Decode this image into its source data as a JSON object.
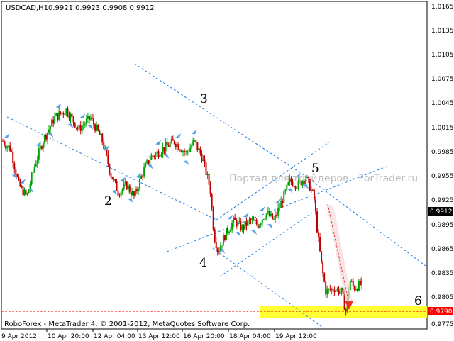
{
  "header": {
    "symbol": "USDCAD,H1",
    "ohlc": "0.9921 0.9923 0.9908 0.9912"
  },
  "footer": {
    "broker": "RoboForex - MetaTrader 4, © 2001-2012, MetaQuotes Software Corp."
  },
  "watermark": "Портал для трейдеров - ForTrader.ru",
  "price_axis": {
    "ticks": [
      "1.0165",
      "1.0135",
      "1.0105",
      "1.0075",
      "1.0045",
      "1.0015",
      "0.9985",
      "0.9955",
      "0.9925",
      "0.9895",
      "0.9865",
      "0.9835",
      "0.9805",
      "0.9775"
    ],
    "current_price": "0.9912",
    "target_price": "0.9790"
  },
  "time_axis": {
    "ticks": [
      "9 Apr 2012",
      "10 Apr 20:00",
      "12 Apr 04:00",
      "13 Apr 12:00",
      "16 Apr 20:00",
      "18 Apr 04:00",
      "19 Apr 12:00"
    ]
  },
  "wave_labels": [
    "2",
    "3",
    "4",
    "5",
    "6"
  ],
  "colors": {
    "bull": "#00a000",
    "bear": "#c00000",
    "channel": "#1e7fe0",
    "target_zone": "#ffff33",
    "target_line": "#ff0000",
    "arrow": "#e53030",
    "fractal": "#5aa0e8",
    "price_box": "#000000"
  },
  "chart_data": {
    "type": "candlestick",
    "symbol": "USDCAD",
    "timeframe": "H1",
    "last_close": 0.9912,
    "target_level": 0.979,
    "ylim": [
      0.9765,
      1.0175
    ],
    "x_ticks": [
      "9 Apr 2012",
      "10 Apr 20:00",
      "12 Apr 04:00",
      "13 Apr 12:00",
      "16 Apr 20:00",
      "18 Apr 04:00",
      "19 Apr 12:00"
    ],
    "y_ticks": [
      1.0165,
      1.0135,
      1.0105,
      1.0075,
      1.0045,
      1.0015,
      0.9985,
      0.9955,
      0.9925,
      0.9895,
      0.9865,
      0.9835,
      0.9805,
      0.9775
    ],
    "close_path": [
      [
        0.0,
        1.0
      ],
      [
        0.02,
        0.999
      ],
      [
        0.04,
        0.9945
      ],
      [
        0.06,
        0.993
      ],
      [
        0.08,
        0.997
      ],
      [
        0.1,
        1.0
      ],
      [
        0.13,
        1.003
      ],
      [
        0.16,
        1.004
      ],
      [
        0.19,
        1.0015
      ],
      [
        0.22,
        1.003
      ],
      [
        0.25,
        1.0
      ],
      [
        0.27,
        0.996
      ],
      [
        0.29,
        0.9935
      ],
      [
        0.31,
        0.9945
      ],
      [
        0.33,
        0.993
      ],
      [
        0.35,
        0.996
      ],
      [
        0.37,
        0.998
      ],
      [
        0.4,
        0.999
      ],
      [
        0.43,
        1.0
      ],
      [
        0.46,
        0.9985
      ],
      [
        0.48,
        1.0
      ],
      [
        0.5,
        0.998
      ],
      [
        0.52,
        0.994
      ],
      [
        0.53,
        0.988
      ],
      [
        0.54,
        0.9862
      ],
      [
        0.56,
        0.9885
      ],
      [
        0.58,
        0.99
      ],
      [
        0.6,
        0.989
      ],
      [
        0.62,
        0.99
      ],
      [
        0.64,
        0.9895
      ],
      [
        0.66,
        0.991
      ],
      [
        0.68,
        0.99
      ],
      [
        0.7,
        0.9925
      ],
      [
        0.72,
        0.995
      ],
      [
        0.74,
        0.9945
      ],
      [
        0.76,
        0.9955
      ],
      [
        0.78,
        0.993
      ],
      [
        0.79,
        0.988
      ],
      [
        0.8,
        0.984
      ],
      [
        0.81,
        0.981
      ],
      [
        0.83,
        0.9815
      ],
      [
        0.85,
        0.981
      ],
      [
        0.86,
        0.9785
      ],
      [
        0.87,
        0.9825
      ],
      [
        0.88,
        0.9815
      ],
      [
        0.9,
        0.982
      ]
    ]
  }
}
